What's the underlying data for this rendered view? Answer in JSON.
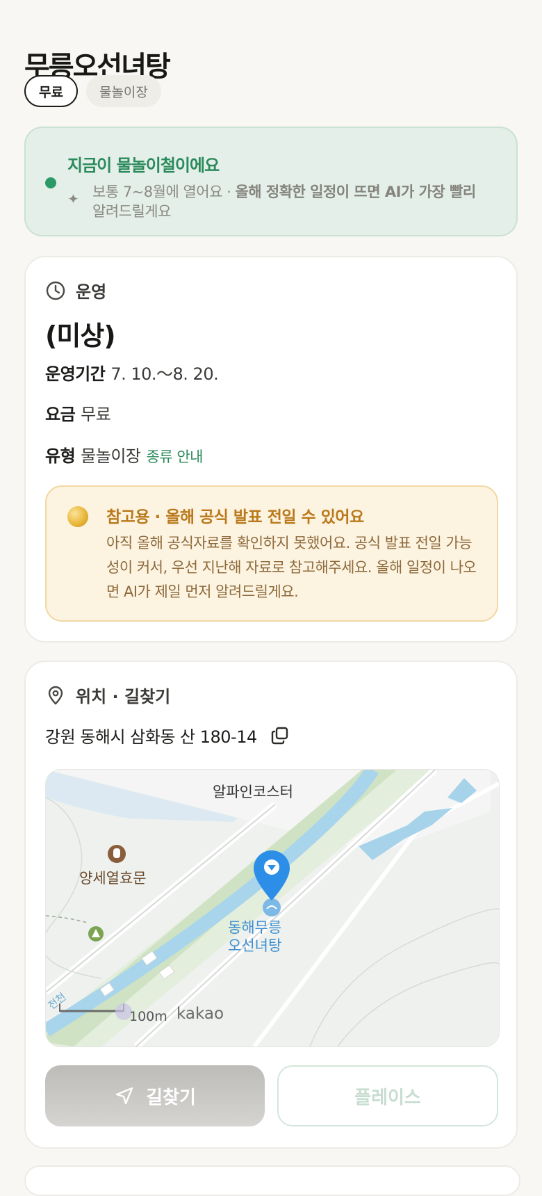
{
  "header": {
    "title": "무릉오선녀탕",
    "chips": [
      "무료",
      "물놀이장"
    ]
  },
  "season_banner": {
    "title": "지금이 물놀이철이에요",
    "desc_plain": "보통 7~8월에 열어요 · ",
    "desc_bold": "올해 정확한 일정이 뜨면 AI가 가장 빨리",
    "desc_tail": "알려드릴게요",
    "accent_color": "#2b9a66"
  },
  "operation": {
    "section_title": "운영",
    "status": "(미상)",
    "rows": [
      {
        "key": "운영기간",
        "value": "7. 10.～8. 20."
      },
      {
        "key": "요금",
        "value": "무료"
      },
      {
        "key": "유형",
        "value": "물놀이장",
        "link": "종류 안내"
      }
    ],
    "notice": {
      "title": "참고용 · 올해 공식 발표 전일 수 있어요",
      "body": "아직 올해 공식자료를 확인하지 못했어요. 공식 발표 전일 가능성이 커서, 우선 지난해 자료로 참고해주세요. 올해 일정이 나오면 AI가 제일 먼저 알려드릴게요."
    }
  },
  "location": {
    "section_title": "위치 · 길찾기",
    "address": "강원 동해시 삼화동 산 180-14",
    "map": {
      "labels": {
        "alpine": "알파인코스터",
        "yang": "양세열효문",
        "donghae_line1": "동해무릉",
        "donghae_line2": "오선녀탕",
        "scale": "100m",
        "brand": "kakao",
        "river": "전천"
      },
      "marker_color": "#3b8ed0"
    },
    "buttons": {
      "route": "길찾기",
      "place": "플레이스"
    }
  },
  "icons": [
    "clock-icon",
    "pin-icon",
    "copy-icon",
    "navigate-icon",
    "sparkle-icon",
    "coin-icon"
  ]
}
